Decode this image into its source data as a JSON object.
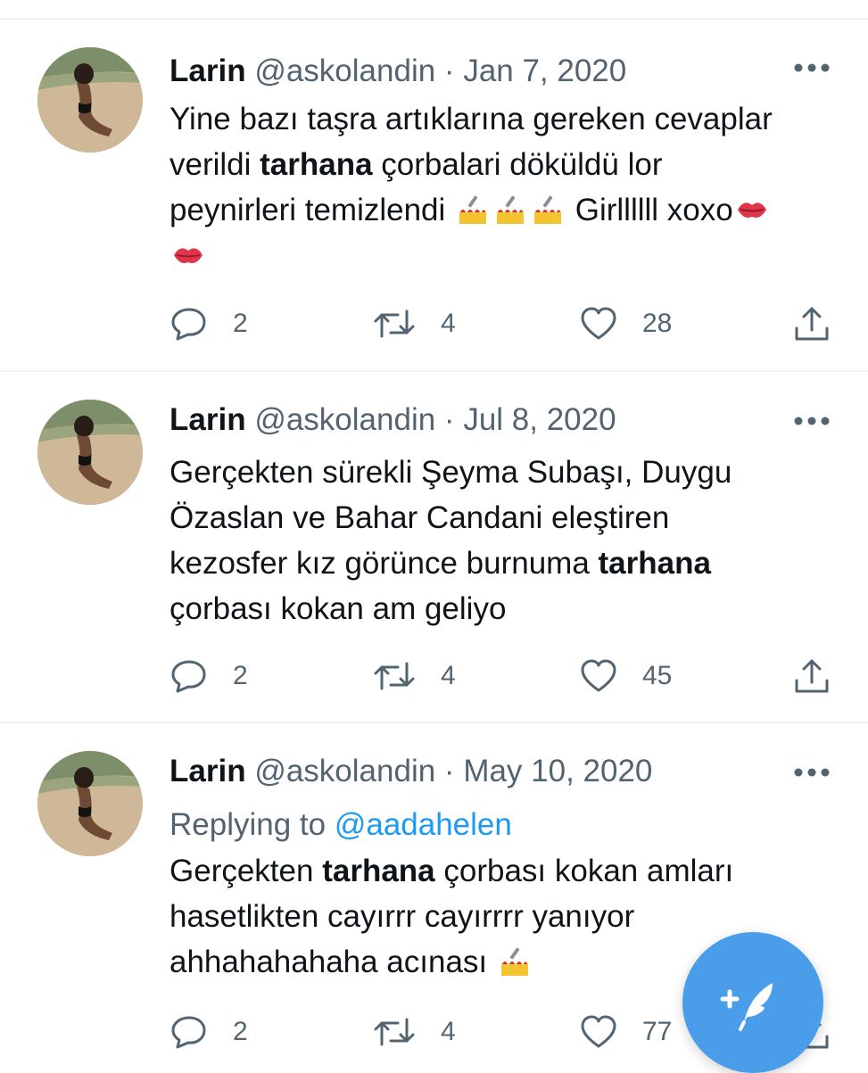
{
  "tweets": [
    {
      "name": "Larin",
      "handle": "@askolandin",
      "separator": "·",
      "date": "Jan 7, 2020",
      "replying_label": "",
      "replying_to": "",
      "text": {
        "l1": "Yine bazı taşra artıklarına gereken cevaplar",
        "l2a": "verildi ",
        "l2b": "tarhana",
        "l2c": " çorbalari döküldü lor",
        "l3a": "peynirleri temizlendi ",
        "l3b": " Girllllll xoxo"
      },
      "emojis": [
        "nail-polish",
        "nail-polish",
        "nail-polish",
        "kiss-mark",
        "kiss-mark"
      ],
      "stats": {
        "replies": "2",
        "retweets": "4",
        "likes": "28"
      }
    },
    {
      "name": "Larin",
      "handle": "@askolandin",
      "separator": "·",
      "date": "Jul 8, 2020",
      "text": {
        "l1": "Gerçekten sürekli Şeyma Subaşı, Duygu",
        "l2": "Özaslan ve Bahar Candani eleştiren",
        "l3a": "kezosfer kız görünce burnuma ",
        "l3b": "tarhana",
        "l4": "çorbası kokan am geliyo"
      },
      "stats": {
        "replies": "2",
        "retweets": "4",
        "likes": "45"
      }
    },
    {
      "name": "Larin",
      "handle": "@askolandin",
      "separator": "·",
      "date": "May 10, 2020",
      "replying_label": "Replying to ",
      "replying_to": "@aadahelen",
      "text": {
        "l1a": "Gerçekten ",
        "l1b": "tarhana",
        "l1c": " çorbası kokan amları",
        "l2": "hasetlikten cayırrr cayırrrr yanıyor",
        "l3": "ahhahahahaha acınası "
      },
      "emojis": [
        "nail-polish"
      ],
      "stats": {
        "replies": "2",
        "retweets": "4",
        "likes": "77"
      }
    }
  ],
  "colors": {
    "accent": "#1d9bf0",
    "muted": "#536471",
    "fab": "#4a9de9"
  },
  "icons": [
    "more-icon",
    "reply-icon",
    "retweet-icon",
    "like-icon",
    "share-icon",
    "compose-tweet-icon"
  ]
}
